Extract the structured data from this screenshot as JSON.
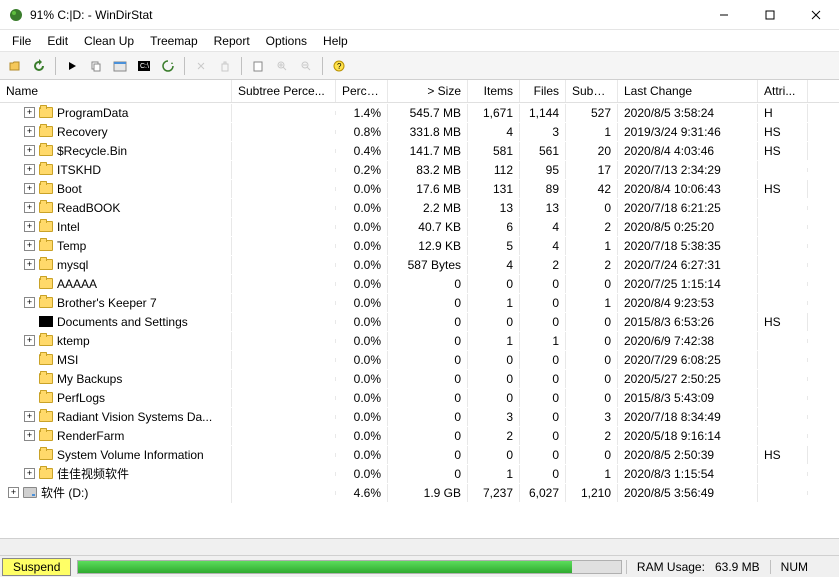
{
  "window": {
    "title": "91% C:|D: - WinDirStat"
  },
  "menu": {
    "file": "File",
    "edit": "Edit",
    "cleanup": "Clean Up",
    "treemap": "Treemap",
    "report": "Report",
    "options": "Options",
    "help": "Help"
  },
  "columns": {
    "name": "Name",
    "subtree": "Subtree Perce...",
    "percentage": "Perce...",
    "size": "> Size",
    "items": "Items",
    "files": "Files",
    "subdirs": "Subdi...",
    "lastchange": "Last Change",
    "attributes": "Attri..."
  },
  "rows": [
    {
      "exp": true,
      "icon": "folder",
      "indent": 1,
      "name": "ProgramData",
      "perc": "1.4%",
      "size": "545.7 MB",
      "items": "1,671",
      "files": "1,144",
      "subdirs": "527",
      "lastchange": "2020/8/5  3:58:24",
      "attrib": "H"
    },
    {
      "exp": true,
      "icon": "folder",
      "indent": 1,
      "name": "Recovery",
      "perc": "0.8%",
      "size": "331.8 MB",
      "items": "4",
      "files": "3",
      "subdirs": "1",
      "lastchange": "2019/3/24  9:31:46",
      "attrib": "HS"
    },
    {
      "exp": true,
      "icon": "folder",
      "indent": 1,
      "name": "$Recycle.Bin",
      "perc": "0.4%",
      "size": "141.7 MB",
      "items": "581",
      "files": "561",
      "subdirs": "20",
      "lastchange": "2020/8/4  4:03:46",
      "attrib": "HS"
    },
    {
      "exp": true,
      "icon": "folder",
      "indent": 1,
      "name": "ITSKHD",
      "perc": "0.2%",
      "size": "83.2 MB",
      "items": "112",
      "files": "95",
      "subdirs": "17",
      "lastchange": "2020/7/13  2:34:29",
      "attrib": ""
    },
    {
      "exp": true,
      "icon": "folder",
      "indent": 1,
      "name": "Boot",
      "perc": "0.0%",
      "size": "17.6 MB",
      "items": "131",
      "files": "89",
      "subdirs": "42",
      "lastchange": "2020/8/4  10:06:43",
      "attrib": "HS"
    },
    {
      "exp": true,
      "icon": "folder",
      "indent": 1,
      "name": "ReadBOOK",
      "perc": "0.0%",
      "size": "2.2 MB",
      "items": "13",
      "files": "13",
      "subdirs": "0",
      "lastchange": "2020/7/18  6:21:25",
      "attrib": ""
    },
    {
      "exp": true,
      "icon": "folder",
      "indent": 1,
      "name": "Intel",
      "perc": "0.0%",
      "size": "40.7 KB",
      "items": "6",
      "files": "4",
      "subdirs": "2",
      "lastchange": "2020/8/5  0:25:20",
      "attrib": ""
    },
    {
      "exp": true,
      "icon": "folder",
      "indent": 1,
      "name": "Temp",
      "perc": "0.0%",
      "size": "12.9 KB",
      "items": "5",
      "files": "4",
      "subdirs": "1",
      "lastchange": "2020/7/18  5:38:35",
      "attrib": ""
    },
    {
      "exp": true,
      "icon": "folder",
      "indent": 1,
      "name": "mysql",
      "perc": "0.0%",
      "size": "587 Bytes",
      "items": "4",
      "files": "2",
      "subdirs": "2",
      "lastchange": "2020/7/24  6:27:31",
      "attrib": ""
    },
    {
      "exp": false,
      "icon": "folder",
      "indent": 1,
      "name": "AAAAA",
      "perc": "0.0%",
      "size": "0",
      "items": "0",
      "files": "0",
      "subdirs": "0",
      "lastchange": "2020/7/25  1:15:14",
      "attrib": ""
    },
    {
      "exp": true,
      "icon": "folder",
      "indent": 1,
      "name": "Brother's Keeper 7",
      "perc": "0.0%",
      "size": "0",
      "items": "1",
      "files": "0",
      "subdirs": "1",
      "lastchange": "2020/8/4  9:23:53",
      "attrib": ""
    },
    {
      "exp": false,
      "icon": "special",
      "indent": 1,
      "name": "Documents and Settings",
      "perc": "0.0%",
      "size": "0",
      "items": "0",
      "files": "0",
      "subdirs": "0",
      "lastchange": "2015/8/3  6:53:26",
      "attrib": "HS"
    },
    {
      "exp": true,
      "icon": "folder",
      "indent": 1,
      "name": "ktemp",
      "perc": "0.0%",
      "size": "0",
      "items": "1",
      "files": "1",
      "subdirs": "0",
      "lastchange": "2020/6/9  7:42:38",
      "attrib": ""
    },
    {
      "exp": false,
      "icon": "folder",
      "indent": 1,
      "name": "MSI",
      "perc": "0.0%",
      "size": "0",
      "items": "0",
      "files": "0",
      "subdirs": "0",
      "lastchange": "2020/7/29  6:08:25",
      "attrib": ""
    },
    {
      "exp": false,
      "icon": "folder",
      "indent": 1,
      "name": "My Backups",
      "perc": "0.0%",
      "size": "0",
      "items": "0",
      "files": "0",
      "subdirs": "0",
      "lastchange": "2020/5/27  2:50:25",
      "attrib": ""
    },
    {
      "exp": false,
      "icon": "folder",
      "indent": 1,
      "name": "PerfLogs",
      "perc": "0.0%",
      "size": "0",
      "items": "0",
      "files": "0",
      "subdirs": "0",
      "lastchange": "2015/8/3  5:43:09",
      "attrib": ""
    },
    {
      "exp": true,
      "icon": "folder",
      "indent": 1,
      "name": "Radiant Vision Systems Da...",
      "perc": "0.0%",
      "size": "0",
      "items": "3",
      "files": "0",
      "subdirs": "3",
      "lastchange": "2020/7/18  8:34:49",
      "attrib": ""
    },
    {
      "exp": true,
      "icon": "folder",
      "indent": 1,
      "name": "RenderFarm",
      "perc": "0.0%",
      "size": "0",
      "items": "2",
      "files": "0",
      "subdirs": "2",
      "lastchange": "2020/5/18  9:16:14",
      "attrib": ""
    },
    {
      "exp": false,
      "icon": "folder",
      "indent": 1,
      "name": "System Volume Information",
      "perc": "0.0%",
      "size": "0",
      "items": "0",
      "files": "0",
      "subdirs": "0",
      "lastchange": "2020/8/5  2:50:39",
      "attrib": "HS"
    },
    {
      "exp": true,
      "icon": "folder",
      "indent": 1,
      "name": "佳佳视频软件",
      "perc": "0.0%",
      "size": "0",
      "items": "1",
      "files": "0",
      "subdirs": "1",
      "lastchange": "2020/8/3  1:15:54",
      "attrib": ""
    },
    {
      "exp": true,
      "icon": "disk",
      "indent": 0,
      "name": "软件 (D:)",
      "perc": "4.6%",
      "size": "1.9 GB",
      "items": "7,237",
      "files": "6,027",
      "subdirs": "1,210",
      "lastchange": "2020/8/5  3:56:49",
      "attrib": ""
    }
  ],
  "status": {
    "suspend": "Suspend",
    "ram_label": "RAM Usage:",
    "ram_value": "63.9 MB",
    "num": "NUM"
  }
}
